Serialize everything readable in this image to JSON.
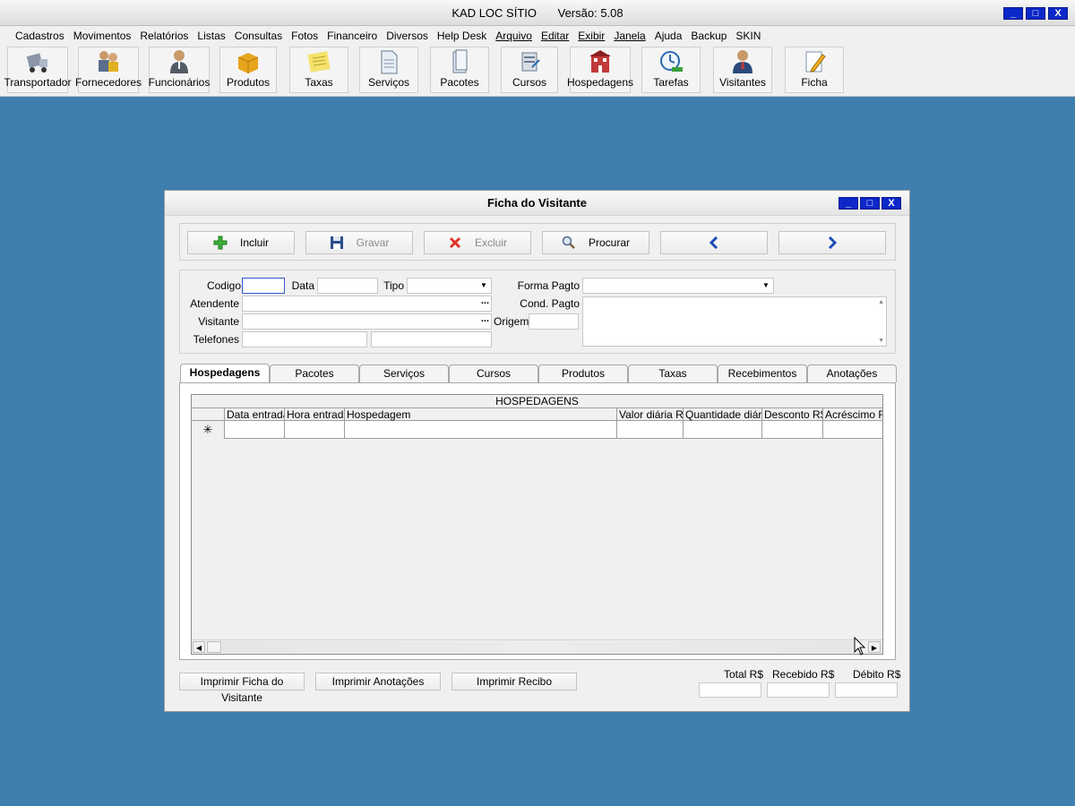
{
  "app": {
    "name": "KAD LOC SÍTIO",
    "version": "Versão: 5.08",
    "win_min": "_",
    "win_max": "□",
    "win_close": "X"
  },
  "menu": [
    "Cadastros",
    "Movimentos",
    "Relatórios",
    "Listas",
    "Consultas",
    "Fotos",
    "Financeiro",
    "Diversos",
    "Help Desk",
    "Arquivo",
    "Editar",
    "Exibir",
    "Janela",
    "Ajuda",
    "Backup",
    "SKIN"
  ],
  "toolbar": [
    {
      "label": "Transportador",
      "icon": "truck-icon"
    },
    {
      "label": "Fornecedores",
      "icon": "suppliers-icon"
    },
    {
      "label": "Funcionários",
      "icon": "employee-icon"
    },
    {
      "label": "Produtos",
      "icon": "box-icon"
    },
    {
      "label": "Taxas",
      "icon": "notes-icon"
    },
    {
      "label": "Serviços",
      "icon": "document-icon"
    },
    {
      "label": "Pacotes",
      "icon": "package-icon"
    },
    {
      "label": "Cursos",
      "icon": "courses-icon"
    },
    {
      "label": "Hospedagens",
      "icon": "hotel-icon"
    },
    {
      "label": "Tarefas",
      "icon": "clock-icon"
    },
    {
      "label": "Visitantes",
      "icon": "visitor-icon"
    },
    {
      "label": "Ficha",
      "icon": "pencil-icon"
    }
  ],
  "dialog": {
    "title": "Ficha do Visitante",
    "actions": {
      "incluir": "Incluir",
      "gravar": "Gravar",
      "excluir": "Excluir",
      "procurar": "Procurar",
      "prev": "‹",
      "next": "›"
    },
    "fields": {
      "codigo": "Codigo",
      "data": "Data",
      "tipo": "Tipo",
      "atendente": "Atendente",
      "visitante": "Visitante",
      "telefones": "Telefones",
      "forma_pagto": "Forma Pagto",
      "cond_pagto": "Cond. Pagto",
      "origem": "Origem",
      "ellipsis": "..."
    },
    "tabs": [
      "Hospedagens",
      "Pacotes",
      "Serviços",
      "Cursos",
      "Produtos",
      "Taxas",
      "Recebimentos",
      "Anotações"
    ],
    "grid": {
      "caption": "HOSPEDAGENS",
      "columns": [
        "Data entrada",
        "Hora entrada",
        "Hospedagem",
        "Valor diária R$",
        "Quantidade diária",
        "Desconto R$",
        "Acréscimo R$"
      ],
      "new_row_marker": "✳"
    },
    "print": {
      "ficha": "Imprimir Ficha do Visitante",
      "anotacoes": "Imprimir Anotações",
      "recibo": "Imprimir Recibo"
    },
    "totals": {
      "total": "Total R$",
      "recebido": "Recebido R$",
      "debito": "Débito R$"
    }
  }
}
